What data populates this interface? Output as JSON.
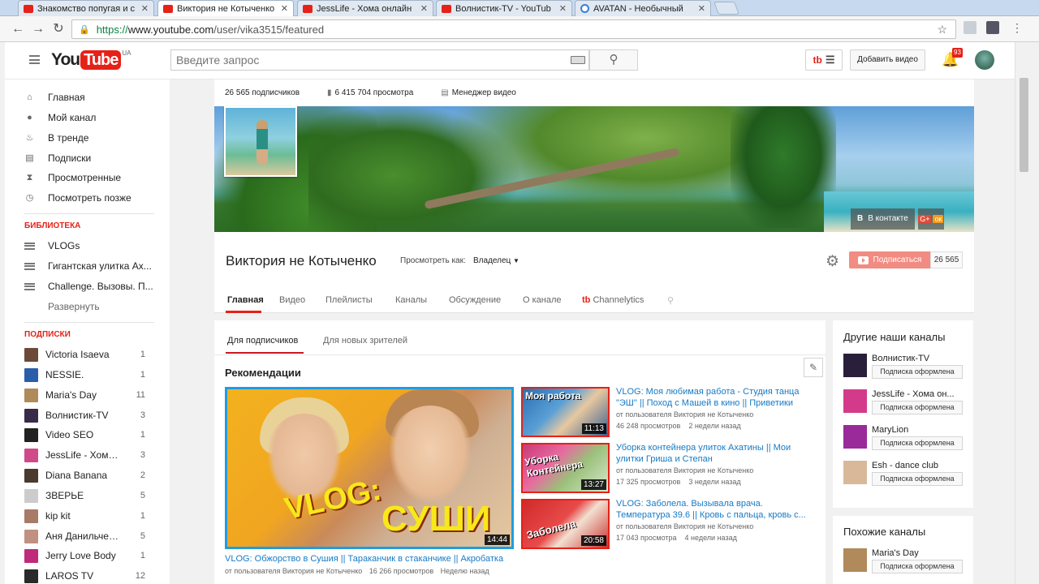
{
  "browser": {
    "tabs": [
      {
        "title": "Знакомство попугая и с",
        "icon": "youtube-icon"
      },
      {
        "title": "Виктория не Котыченко",
        "icon": "youtube-icon",
        "active": true
      },
      {
        "title": "JessLife - Хома онлайн",
        "icon": "youtube-icon"
      },
      {
        "title": "Волнистик-TV - YouTub",
        "icon": "youtube-icon"
      },
      {
        "title": "AVATAN - Необычный",
        "icon": "avatan-icon"
      }
    ],
    "url_scheme": "https://",
    "url_host": "www.youtube.com",
    "url_path": "/user/vika3515/featured"
  },
  "masthead": {
    "logo_you": "You",
    "logo_tube": "Tube",
    "logo_region": "UA",
    "search_placeholder": "Введите запрос",
    "tb_label": "tb",
    "upload_label": "Добавить видео",
    "notifications": "93"
  },
  "sidebar": {
    "nav": [
      {
        "label": "Главная",
        "icon": "home-icon"
      },
      {
        "label": "Мой канал",
        "icon": "person-icon"
      },
      {
        "label": "В тренде",
        "icon": "flame-icon"
      },
      {
        "label": "Подписки",
        "icon": "subscriptions-icon"
      },
      {
        "label": "Просмотренные",
        "icon": "hourglass-icon"
      },
      {
        "label": "Посмотреть позже",
        "icon": "clock-icon"
      }
    ],
    "library_title": "БИБЛИОТЕКА",
    "library": [
      {
        "label": "VLOGs"
      },
      {
        "label": "Гигантская улитка Ах..."
      },
      {
        "label": "Challenge. Вызовы. П..."
      }
    ],
    "expand_label": "Развернуть",
    "subs_title": "ПОДПИСКИ",
    "subscriptions": [
      {
        "name": "Victoria Isaeva",
        "count": "1",
        "color": "#6b4a3a"
      },
      {
        "name": "NESSIE.",
        "count": "1",
        "color": "#2a5ea8"
      },
      {
        "name": "Maria's Day",
        "count": "11",
        "color": "#b08a5a"
      },
      {
        "name": "Волнистик-TV",
        "count": "3",
        "color": "#3a2a4a"
      },
      {
        "name": "Video SEO",
        "count": "1",
        "color": "#222222"
      },
      {
        "name": "JessLife - Хома ...",
        "count": "3",
        "color": "#d04a8a"
      },
      {
        "name": "Diana Banana",
        "count": "2",
        "color": "#4a3a30"
      },
      {
        "name": "ЗВЕРЬЕ",
        "count": "5",
        "color": "#cccccc"
      },
      {
        "name": "kip kit",
        "count": "1",
        "color": "#a87a68"
      },
      {
        "name": "Аня Данильченко",
        "count": "5",
        "color": "#c09080"
      },
      {
        "name": "Jerry Love Body",
        "count": "1",
        "color": "#c02a7a"
      },
      {
        "name": "LAROS TV",
        "count": "12",
        "color": "#2a2a2a"
      }
    ]
  },
  "channel": {
    "subscribers_stat": "26 565 подписчиков",
    "views_stat": "6 415 704 просмотра",
    "manager_label": "Менеджер видео",
    "name": "Виктория не Котыченко",
    "view_as_label": "Просмотреть как:",
    "view_as_value": "Владелец",
    "social_vk_letter": "В",
    "social_vk": "В контакте",
    "social_g": "G+",
    "social_ok": "ок",
    "subscribe_label": "Подписаться",
    "subscribe_count": "26 565",
    "tabs": [
      {
        "label": "Главная",
        "active": true
      },
      {
        "label": "Видео"
      },
      {
        "label": "Плейлисты"
      },
      {
        "label": "Каналы"
      },
      {
        "label": "Обсуждение"
      },
      {
        "label": "О канале"
      },
      {
        "label": "Channelytics"
      }
    ]
  },
  "content": {
    "subtabs": [
      "Для подписчиков",
      "Для новых зрителей"
    ],
    "section_title": "Рекомендации",
    "featured": {
      "overlay_vlog": "VLOG:",
      "overlay_sushi": "СУШИ",
      "duration": "14:44",
      "title": "VLOG: Обжорство в Сушия || Тараканчик в стаканчике || Акробатка",
      "by": "от пользователя Виктория не Котыченко",
      "views": "16 266 просмотров",
      "age": "Неделю назад"
    },
    "videos": [
      {
        "title": "VLOG: Моя любимая работа - Студия танца \"ЭШ\" || Поход с Машей в кино || Приветики",
        "by": "от пользователя Виктория не Котыченко",
        "views": "46 248 просмотров",
        "age": "2 недели назад",
        "duration": "11:13",
        "overlay": "Моя работа"
      },
      {
        "title": "Уборка контейнера улиток Ахатины || Мои улитки Гриша и Степан",
        "by": "от пользователя Виктория не Котыченко",
        "views": "17 325 просмотров",
        "age": "3 недели назад",
        "duration": "13:27",
        "overlay": "Уборка Контейнера"
      },
      {
        "title": "VLOG: Заболела. Вызывала врача. Температура 39.6 || Кровь с пальца, кровь с...",
        "by": "от пользователя Виктория не Котыченко",
        "views": "17 043 просмотра",
        "age": "4 недели назад",
        "duration": "20:58",
        "overlay": "Заболела"
      }
    ]
  },
  "right": {
    "other_title": "Другие наши каналы",
    "other": [
      {
        "name": "Волнистик-TV",
        "button": "Подписка оформлена",
        "color": "#2a1f3a"
      },
      {
        "name": "JessLife - Хома он...",
        "button": "Подписка оформлена",
        "color": "#d43a8a"
      },
      {
        "name": "MaryLion",
        "button": "Подписка оформлена",
        "color": "#9a2a9a"
      },
      {
        "name": "Esh - dance club",
        "button": "Подписка оформлена",
        "color": "#d9b89a"
      }
    ],
    "similar_title": "Похожие каналы",
    "similar": [
      {
        "name": "Maria's Day",
        "button": "Подписка оформлена",
        "color": "#b08a5a"
      }
    ]
  }
}
